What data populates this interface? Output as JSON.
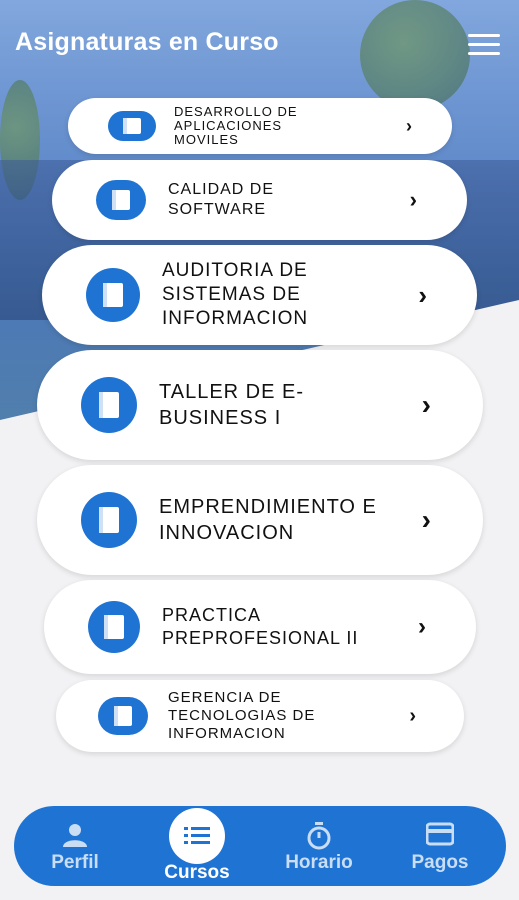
{
  "header": {
    "title": "Asignaturas en Curso",
    "menu_icon": "hamburger-menu-icon"
  },
  "courses": [
    {
      "name": "DESARROLLO DE\nAPLICACIONES\nMOVILES"
    },
    {
      "name": "CALIDAD DE\nSOFTWARE"
    },
    {
      "name": "AUDITORIA DE\nSISTEMAS DE\nINFORMACION"
    },
    {
      "name": "TALLER DE E-\nBUSINESS I"
    },
    {
      "name": "EMPRENDIMIENTO E\nINNOVACION"
    },
    {
      "name": "PRACTICA\nPREPROFESIONAL II"
    },
    {
      "name": "GERENCIA DE\nTECNOLOGIAS DE\nINFORMACION"
    }
  ],
  "chevron": "›",
  "bottom_nav": {
    "perfil": "Perfil",
    "cursos": "Cursos",
    "horario": "Horario",
    "pagos": "Pagos",
    "active": "Cursos"
  },
  "colors": {
    "primary": "#1f74d3",
    "card": "#ffffff",
    "background": "#f2f2f4"
  }
}
